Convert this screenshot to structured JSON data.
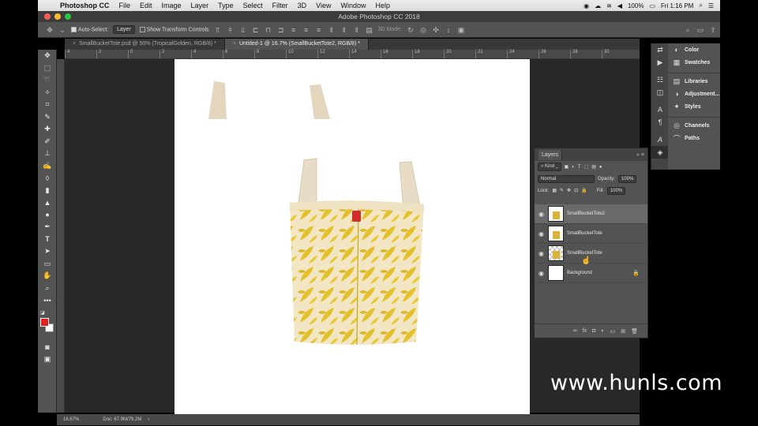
{
  "menubar": {
    "app": "Photoshop CC",
    "items": [
      "File",
      "Edit",
      "Image",
      "Layer",
      "Type",
      "Select",
      "Filter",
      "3D",
      "View",
      "Window",
      "Help"
    ],
    "battery": "100%",
    "clock": "Fri 1:16 PM"
  },
  "window": {
    "title": "Adobe Photoshop CC 2018"
  },
  "options": {
    "auto_select_label": "Auto-Select:",
    "auto_select_value": "Layer",
    "transform_label": "Show Transform Controls",
    "mode_3d": "3D Mode:"
  },
  "tabs": [
    {
      "label": "SmallBucketTote.psd @ 50% (TropicalGolden, RGB/8) *"
    },
    {
      "label": "Untitled-1 @ 16.7% (SmallBucketTote2, RGB/8) *"
    }
  ],
  "ruler_marks": [
    "4",
    "2",
    "0",
    "2",
    "4",
    "6",
    "8",
    "10",
    "12",
    "14",
    "16",
    "18",
    "20",
    "22",
    "24",
    "26",
    "28",
    "30"
  ],
  "status": {
    "zoom": "16.67%",
    "doc": "Doc: 67.9M/79.2M"
  },
  "right_panel": [
    {
      "icon": "color-icon",
      "label": "Color"
    },
    {
      "icon": "swatches-icon",
      "label": "Swatches"
    },
    {
      "icon": "libraries-icon",
      "label": "Libraries"
    },
    {
      "icon": "adjustments-icon",
      "label": "Adjustment..."
    },
    {
      "icon": "styles-icon",
      "label": "Styles"
    },
    {
      "icon": "channels-icon",
      "label": "Channels"
    },
    {
      "icon": "paths-icon",
      "label": "Paths"
    }
  ],
  "layers_panel": {
    "title": "Layers",
    "filter": "Kind",
    "blend": "Normal",
    "opacity_label": "Opacity:",
    "opacity": "100%",
    "lock_label": "Lock:",
    "fill_label": "Fill:",
    "fill": "100%",
    "layers": [
      {
        "name": "SmallBucketTote2",
        "active": true
      },
      {
        "name": "SmallBucketTote",
        "active": false
      },
      {
        "name": "SmallBucketTote",
        "active": false
      },
      {
        "name": "Background",
        "active": false
      }
    ]
  },
  "watermark": "www.hunls.com"
}
